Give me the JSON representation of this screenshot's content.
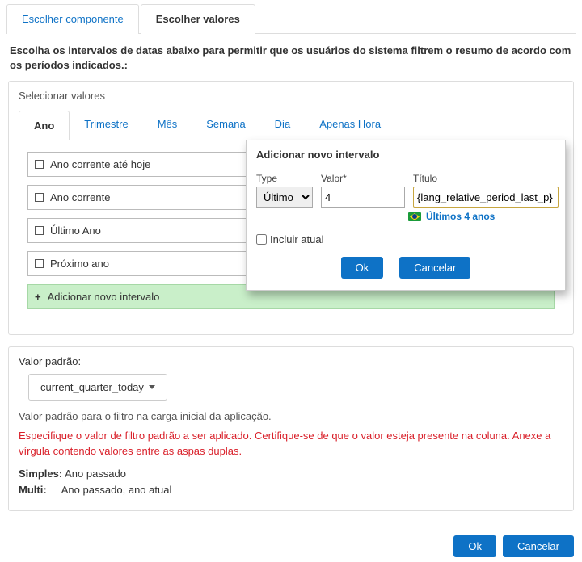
{
  "topTabs": {
    "component": "Escolher componente",
    "values": "Escolher valores"
  },
  "description": "Escolha os intervalos de datas abaixo para permitir que os usuários do sistema filtrem o resumo de acordo com os períodos indicados.:",
  "panel": {
    "select": "Selecionar valores"
  },
  "innerTabs": {
    "year": "Ano",
    "quarter": "Trimestre",
    "month": "Mês",
    "week": "Semana",
    "day": "Dia",
    "hourOnly": "Apenas Hora"
  },
  "items": {
    "i0": "Ano corrente até hoje",
    "i1": "Ano corrente",
    "i2": "Último Ano",
    "i3": "Próximo ano"
  },
  "addNew": "Adicionar novo intervalo",
  "pop": {
    "title": "Adicionar novo intervalo",
    "typeLabel": "Type",
    "typeValue": "Último",
    "valorLabel": "Valor*",
    "valorValue": "4",
    "tituloLabel": "Título",
    "tituloValue": "{lang_relative_period_last_p}",
    "preview": "Últimos 4 anos",
    "incluir": "Incluir atual",
    "ok": "Ok",
    "cancel": "Cancelar"
  },
  "defaults": {
    "label": "Valor padrão:",
    "value": "current_quarter_today",
    "hint": "Valor padrão para o filtro na carga inicial da aplicação.",
    "warn": "Especifique o valor de filtro padrão a ser aplicado. Certifique-se de que o valor esteja presente na coluna. Anexe a vírgula contendo valores entre as aspas duplas.",
    "simplesLabel": "Simples:",
    "simplesVal": "Ano passado",
    "multiLabel": "Multi:",
    "multiVal": "Ano passado, ano atual"
  },
  "footer": {
    "ok": "Ok",
    "cancel": "Cancelar"
  }
}
